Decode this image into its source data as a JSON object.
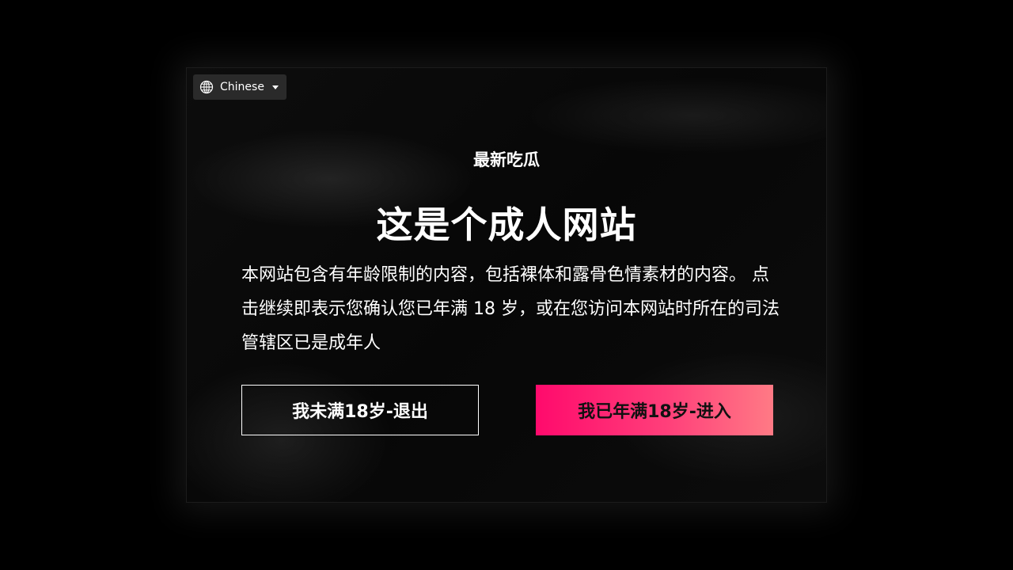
{
  "language_selector": {
    "label": "Chinese",
    "icon": "globe-icon"
  },
  "site_name": "最新吃瓜",
  "headline": "这是个成人网站",
  "body": "本网站包含有年龄限制的内容，包括裸体和露骨色情素材的内容。 点击继续即表示您确认您已年满 18 岁，或在您访问本网站时所在的司法管辖区已是成年人",
  "buttons": {
    "exit_label": "我未满18岁-退出",
    "enter_label": "我已年满18岁-进入"
  },
  "colors": {
    "enter_gradient_start": "#ff0a6c",
    "enter_gradient_end": "#ff7a85",
    "background": "#000000"
  }
}
